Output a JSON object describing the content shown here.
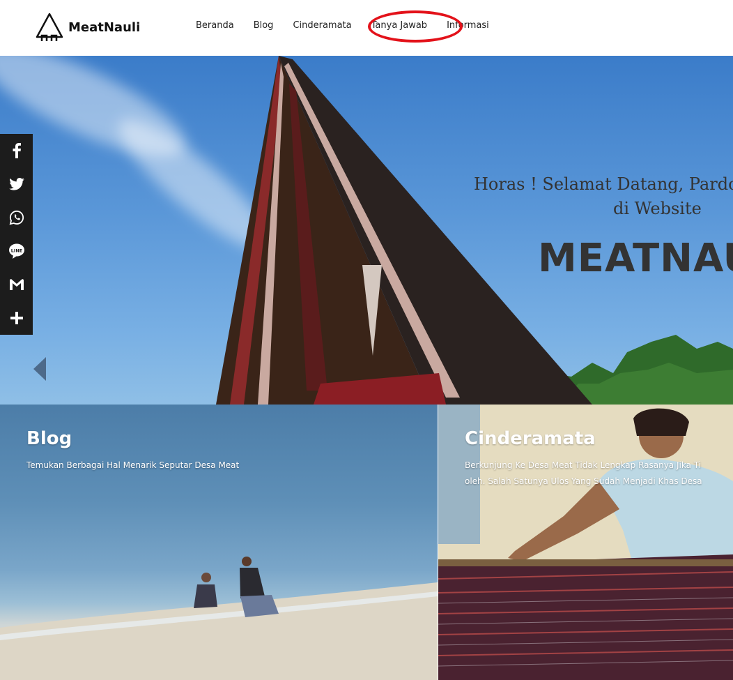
{
  "header": {
    "logo_text": "MeatNauli",
    "nav": [
      "Beranda",
      "Blog",
      "Cinderamata",
      "Tanya Jawab",
      "Informasi"
    ]
  },
  "hero": {
    "welcome_line1": "Horas ! Selamat Datang, Pardo",
    "welcome_line2": "di Website",
    "brand": "MEATNAU"
  },
  "social": [
    "facebook-icon",
    "twitter-icon",
    "whatsapp-icon",
    "line-icon",
    "gmail-icon",
    "plus-icon"
  ],
  "social_glyphs": [
    "f",
    "🐦",
    "✆",
    "LINE",
    "M",
    "+"
  ],
  "cards": {
    "blog": {
      "title": "Blog",
      "desc": "Temukan Berbagai Hal Menarik Seputar Desa Meat"
    },
    "cinderamata": {
      "title": "Cinderamata",
      "desc_line1": "Berkunjung Ke Desa Meat Tidak Lengkap Rasanya Jika Ti",
      "desc_line2": "oleh. Salah Satunya Ulos Yang Sudah Menjadi Khas Desa"
    }
  },
  "colors": {
    "highlight": "#e3121a",
    "social_bar": "#1c1c1c"
  }
}
